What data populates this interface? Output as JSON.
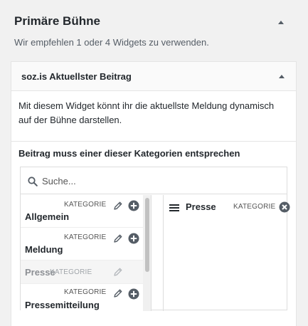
{
  "area": {
    "title": "Primäre Bühne",
    "description": "Wir empfehlen 1 oder 4 Widgets zu verwenden."
  },
  "widget": {
    "title": "soz.is Aktuellster Beitrag",
    "description": "Mit diesem Widget könnt ihr die aktuellste Meldung dynamisch auf der Bühne darstellen.",
    "field_label": "Beitrag muss einer dieser Kategorien entsprechen"
  },
  "search": {
    "placeholder": "Suche..."
  },
  "available": [
    {
      "type": "KATEGORIE",
      "name": "Allgemein"
    },
    {
      "type": "KATEGORIE",
      "name": "Meldung"
    },
    {
      "type": "KATEGORIE",
      "name": "Presse"
    },
    {
      "type": "KATEGORIE",
      "name": "Pressemitteilung"
    }
  ],
  "selected": [
    {
      "type": "KATEGORIE",
      "name": "Presse"
    }
  ],
  "icons": {
    "toggle": "triangle-up-icon",
    "search": "search-icon",
    "edit": "pencil-icon",
    "add": "plus-circle-icon",
    "drag": "drag-handle-icon",
    "remove": "remove-circle-icon"
  },
  "colors": {
    "background": "#f1f1f1",
    "panel": "#ffffff",
    "text": "#23282d",
    "icon": "#555d66",
    "disabled": "#a0a5aa"
  }
}
